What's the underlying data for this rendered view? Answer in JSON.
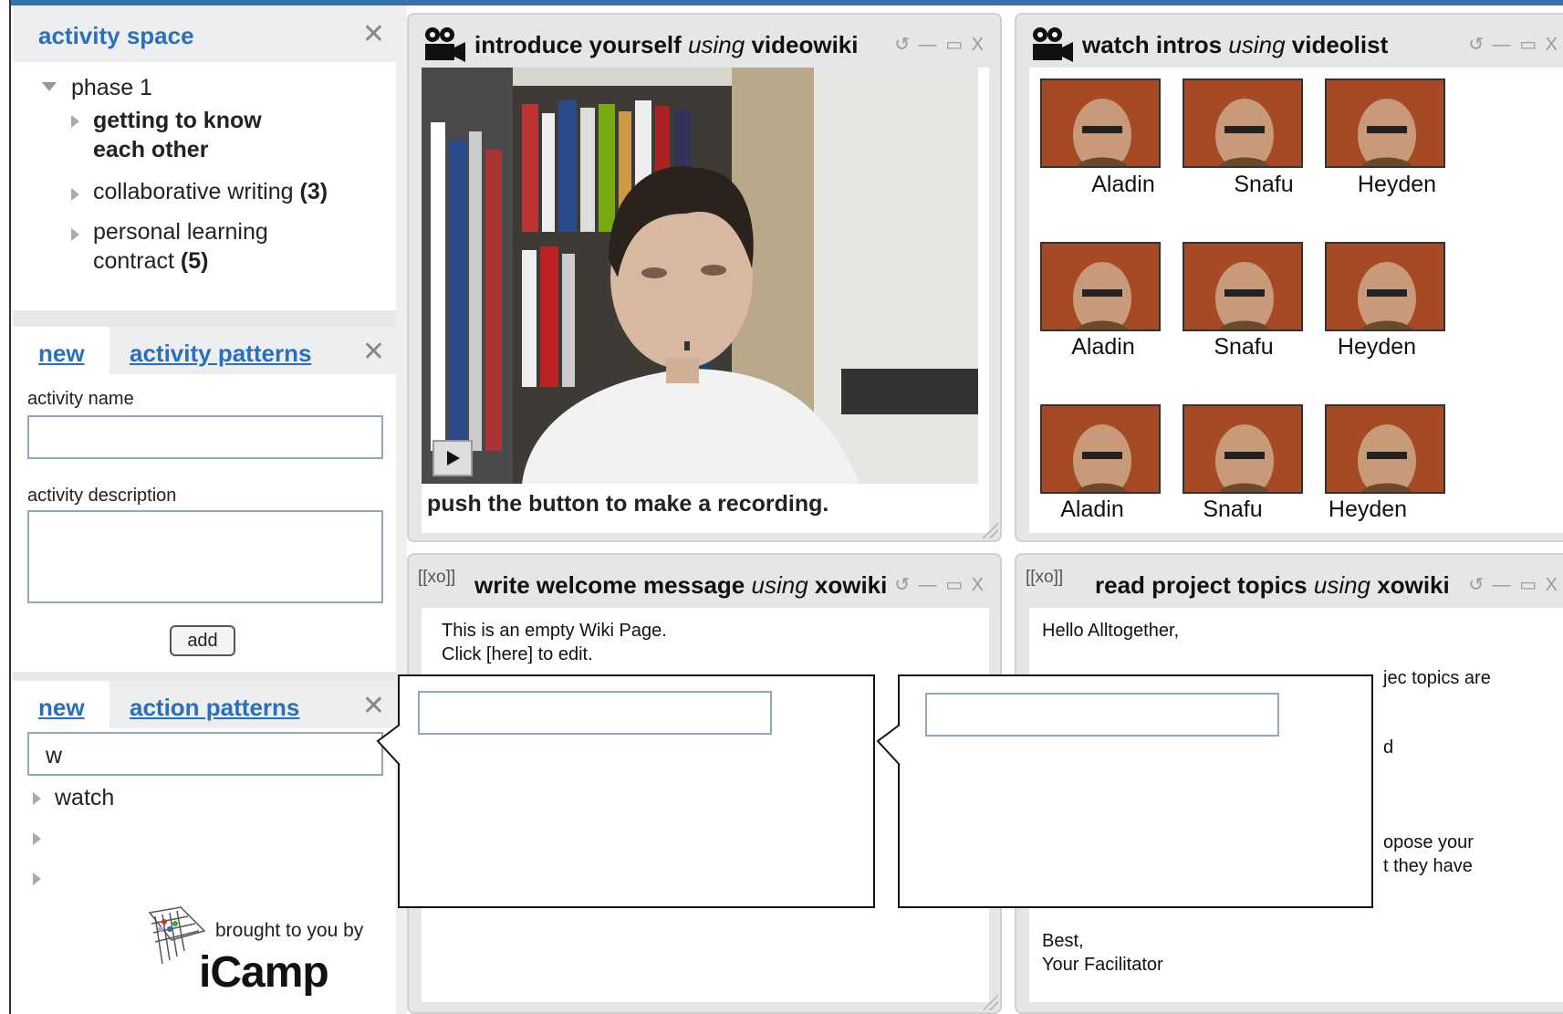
{
  "sidebar": {
    "activity_space": {
      "title": "activity space",
      "close": "✕",
      "tree": {
        "phase": "phase 1",
        "items": [
          {
            "label_line1": "getting to know",
            "label_line2": "each other"
          },
          {
            "label": "collaborative writing",
            "count": "(3)"
          },
          {
            "label_line1": "personal learning",
            "label_line2": "contract",
            "count": "(5)"
          }
        ]
      }
    },
    "activity_panel": {
      "tab_new": "new",
      "tab_patterns": "activity patterns",
      "close": "✕",
      "name_label": "activity name",
      "name_value": "",
      "description_label": "activity description",
      "description_value": "",
      "add_button": "add"
    },
    "action_panel": {
      "tab_new": "new",
      "tab_patterns": "action patterns",
      "close": "✕",
      "search_value": "w",
      "items": [
        "watch",
        "",
        ""
      ]
    },
    "branding": {
      "tagline": "brought to you by",
      "logo": "iCamp"
    }
  },
  "windows": {
    "videowiki": {
      "title_action": "introduce yourself",
      "title_using": "using",
      "title_tool": "videowiki",
      "caption": "push the button to make a recording.",
      "controls": "↺ — ▭ X"
    },
    "videolist": {
      "title_action": "watch intros",
      "title_using": "using",
      "title_tool": "videolist",
      "controls": "↺ — ▭ X",
      "rows": [
        [
          "Aladin",
          "Snafu",
          "Heyden"
        ],
        [
          "Aladin",
          "Snafu",
          "Heyden"
        ],
        [
          "Aladin",
          "Snafu",
          "Heyden"
        ]
      ]
    },
    "welcome": {
      "icon": "[[xo]]",
      "title_action": "write welcome message",
      "title_using": "using",
      "title_tool": "xowiki",
      "controls": "↺ — ▭ X",
      "text": "This is an empty Wiki Page.\nClick [here] to edit."
    },
    "topics": {
      "icon": "[[xo]]",
      "title_action": "read project topics",
      "title_using": "using",
      "title_tool": "xowiki",
      "controls": "↺ — ▭ X",
      "greeting": "Hello Alltogether,",
      "fragment_1": "jec topics are",
      "fragment_2": "d",
      "fragment_3": "opose your",
      "fragment_4": "t they have",
      "signoff": "Best,\nYour Facilitator"
    }
  },
  "callouts": {
    "left_value": "",
    "right_value": ""
  },
  "colors": {
    "link": "#2a6fbd",
    "panel_gray": "#eceeef",
    "window_frame": "#e6e6e6"
  }
}
